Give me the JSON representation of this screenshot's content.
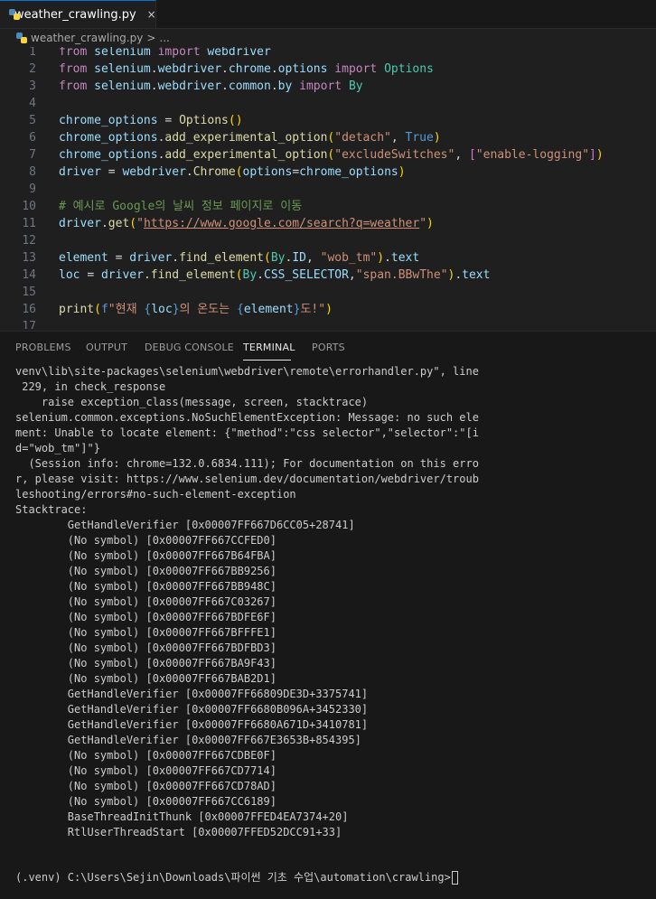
{
  "tab": {
    "filename": "weather_crawling.py",
    "close_glyph": "×"
  },
  "breadcrumb": {
    "file": "weather_crawling.py",
    "separator": ">",
    "more": "..."
  },
  "editor": {
    "line_numbers": [
      "1",
      "2",
      "3",
      "4",
      "5",
      "6",
      "7",
      "8",
      "9",
      "10",
      "11",
      "12",
      "13",
      "14",
      "15",
      "16",
      "17"
    ],
    "lines": [
      "from selenium import webdriver",
      "from selenium.webdriver.chrome.options import Options",
      "from selenium.webdriver.common.by import By",
      "",
      "chrome_options = Options()",
      "chrome_options.add_experimental_option(\"detach\", True)",
      "chrome_options.add_experimental_option(\"excludeSwitches\", [\"enable-logging\"])",
      "driver = webdriver.Chrome(options=chrome_options)",
      "",
      "# 예시로 Google의 날씨 정보 페이지로 이동",
      "driver.get(\"https://www.google.com/search?q=weather\")",
      "",
      "element = driver.find_element(By.ID, \"wob_tm\").text",
      "loc = driver.find_element(By.CSS_SELECTOR,\"span.BBwThe\").text",
      "",
      "print(f\"현재 {loc}의 온도는 {element}도!\")",
      ""
    ]
  },
  "panel": {
    "tabs": [
      "PROBLEMS",
      "OUTPUT",
      "DEBUG CONSOLE",
      "TERMINAL",
      "PORTS"
    ],
    "active_tab": "TERMINAL",
    "terminal_lines": [
      "venv\\lib\\site-packages\\selenium\\webdriver\\remote\\errorhandler.py\", line",
      " 229, in check_response",
      "    raise exception_class(message, screen, stacktrace)",
      "selenium.common.exceptions.NoSuchElementException: Message: no such ele",
      "ment: Unable to locate element: {\"method\":\"css selector\",\"selector\":\"[i",
      "d=\"wob_tm\"]\"}",
      "  (Session info: chrome=132.0.6834.111); For documentation on this erro",
      "r, please visit: https://www.selenium.dev/documentation/webdriver/troub",
      "leshooting/errors#no-such-element-exception",
      "Stacktrace:",
      "        GetHandleVerifier [0x00007FF667D6CC05+28741]",
      "        (No symbol) [0x00007FF667CCFED0]",
      "        (No symbol) [0x00007FF667B64FBA]",
      "        (No symbol) [0x00007FF667BB9256]",
      "        (No symbol) [0x00007FF667BB948C]",
      "        (No symbol) [0x00007FF667C03267]",
      "        (No symbol) [0x00007FF667BDFE6F]",
      "        (No symbol) [0x00007FF667BFFFE1]",
      "        (No symbol) [0x00007FF667BDFBD3]",
      "        (No symbol) [0x00007FF667BA9F43]",
      "        (No symbol) [0x00007FF667BAB2D1]",
      "        GetHandleVerifier [0x00007FF66809DE3D+3375741]",
      "        GetHandleVerifier [0x00007FF6680B096A+3452330]",
      "        GetHandleVerifier [0x00007FF6680A671D+3410781]",
      "        GetHandleVerifier [0x00007FF667E3653B+854395]",
      "        (No symbol) [0x00007FF667CDBE0F]",
      "        (No symbol) [0x00007FF667CD7714]",
      "        (No symbol) [0x00007FF667CD78AD]",
      "        (No symbol) [0x00007FF667CC6189]",
      "        BaseThreadInitThunk [0x00007FFED4EA7374+20]",
      "        RtlUserThreadStart [0x00007FFED52DCC91+33]"
    ],
    "prompt": "(.venv) C:\\Users\\Sejin\\Downloads\\파이썬 기초 수업\\automation\\crawling>"
  },
  "colors": {
    "accent": "#0078d4",
    "keyword": "#c586c0",
    "module": "#4ec9b0",
    "variable": "#9cdcfe",
    "function": "#dcdcaa",
    "string": "#ce9178",
    "comment": "#6a9955",
    "boolean": "#569cd6"
  }
}
